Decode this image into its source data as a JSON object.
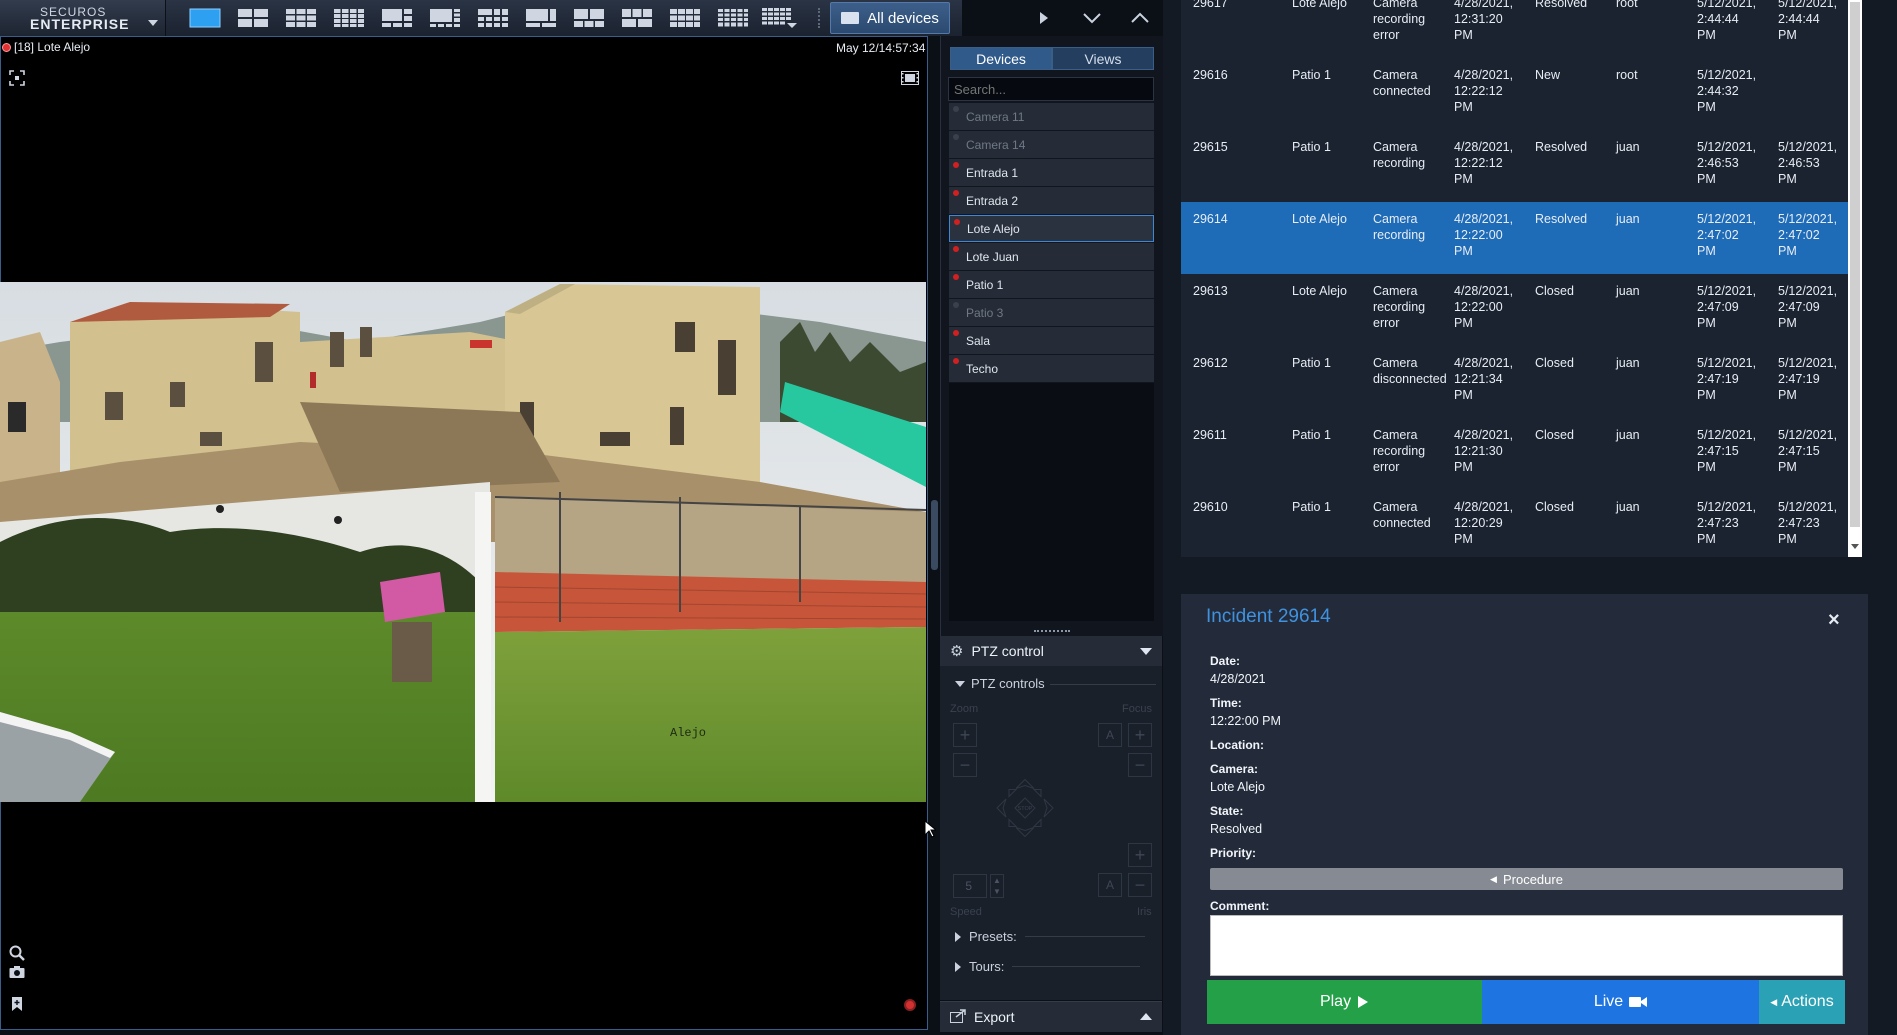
{
  "app": {
    "logo_line1": "SECUROS",
    "logo_line2": "ENTERPRISE",
    "all_devices_label": "All devices"
  },
  "video": {
    "title": "[18] Lote Alejo",
    "timestamp": "May 12/14:57:34",
    "overlay_text": "Alejo"
  },
  "devices_panel": {
    "tab_devices": "Devices",
    "tab_views": "Views",
    "search_placeholder": "Search...",
    "items": [
      {
        "label": "Camera 11",
        "state": "disabled"
      },
      {
        "label": "Camera 14",
        "state": "disabled"
      },
      {
        "label": "Entrada 1",
        "state": "alarm"
      },
      {
        "label": "Entrada 2",
        "state": "alarm"
      },
      {
        "label": "Lote Alejo",
        "state": "alarm",
        "selected": true
      },
      {
        "label": "Lote Juan",
        "state": "alarm"
      },
      {
        "label": "Patio 1",
        "state": "alarm"
      },
      {
        "label": "Patio 3",
        "state": "disabled"
      },
      {
        "label": "Sala",
        "state": "alarm"
      },
      {
        "label": "Techo",
        "state": "alarm"
      }
    ]
  },
  "ptz": {
    "header": "PTZ control",
    "sub_header": "PTZ controls",
    "zoom_label": "Zoom",
    "focus_label": "Focus",
    "stop_label": "STOP",
    "speed_value": "5",
    "speed_label": "Speed",
    "iris_label": "Iris",
    "presets_label": "Presets:",
    "tours_label": "Tours:",
    "export_label": "Export"
  },
  "incidents": {
    "rows": [
      {
        "id": "29617",
        "location": "Lote Alejo",
        "event": "Camera\nrecording\nerror",
        "created": "4/28/2021,\n12:31:20\nPM",
        "state": "Resolved",
        "user": "root",
        "updated": "5/12/2021,\n2:44:44\nPM",
        "closed": "5/12/2021,\n2:44:44\nPM"
      },
      {
        "id": "29616",
        "location": "Patio 1",
        "event": "Camera\nconnected",
        "created": "4/28/2021,\n12:22:12\nPM",
        "state": "New",
        "user": "root",
        "updated": "5/12/2021,\n2:44:32\nPM",
        "closed": ""
      },
      {
        "id": "29615",
        "location": "Patio 1",
        "event": "Camera\nrecording",
        "created": "4/28/2021,\n12:22:12\nPM",
        "state": "Resolved",
        "user": "juan",
        "updated": "5/12/2021,\n2:46:53\nPM",
        "closed": "5/12/2021,\n2:46:53\nPM"
      },
      {
        "id": "29614",
        "location": "Lote Alejo",
        "event": "Camera\nrecording",
        "created": "4/28/2021,\n12:22:00\nPM",
        "state": "Resolved",
        "user": "juan",
        "updated": "5/12/2021,\n2:47:02\nPM",
        "closed": "5/12/2021,\n2:47:02\nPM",
        "selected": true
      },
      {
        "id": "29613",
        "location": "Lote Alejo",
        "event": "Camera\nrecording\nerror",
        "created": "4/28/2021,\n12:22:00\nPM",
        "state": "Closed",
        "user": "juan",
        "updated": "5/12/2021,\n2:47:09\nPM",
        "closed": "5/12/2021,\n2:47:09\nPM"
      },
      {
        "id": "29612",
        "location": "Patio 1",
        "event": "Camera\ndisconnected",
        "created": "4/28/2021,\n12:21:34\nPM",
        "state": "Closed",
        "user": "juan",
        "updated": "5/12/2021,\n2:47:19\nPM",
        "closed": "5/12/2021,\n2:47:19\nPM"
      },
      {
        "id": "29611",
        "location": "Patio 1",
        "event": "Camera\nrecording\nerror",
        "created": "4/28/2021,\n12:21:30\nPM",
        "state": "Closed",
        "user": "juan",
        "updated": "5/12/2021,\n2:47:15\nPM",
        "closed": "5/12/2021,\n2:47:15\nPM"
      },
      {
        "id": "29610",
        "location": "Patio 1",
        "event": "Camera\nconnected",
        "created": "4/28/2021,\n12:20:29\nPM",
        "state": "Closed",
        "user": "juan",
        "updated": "5/12/2021,\n2:47:23\nPM",
        "closed": "5/12/2021,\n2:47:23\nPM"
      }
    ]
  },
  "detail": {
    "title": "Incident 29614",
    "close_glyph": "×",
    "date_label": "Date:",
    "date_value": "4/28/2021",
    "time_label": "Time:",
    "time_value": "12:22:00 PM",
    "location_label": "Location:",
    "camera_label": "Camera:",
    "camera_value": "Lote Alejo",
    "state_label": "State:",
    "state_value": "Resolved",
    "priority_label": "Priority:",
    "procedure_label": "Procedure",
    "comment_label": "Comment:",
    "play_label": "Play",
    "live_label": "Live",
    "actions_label": "Actions"
  },
  "colors": {
    "accent": "#1e6bb8",
    "play": "#24a049",
    "live": "#1e74e0",
    "actions": "#2aa1b4",
    "alarm_indicator": "#d02020"
  }
}
